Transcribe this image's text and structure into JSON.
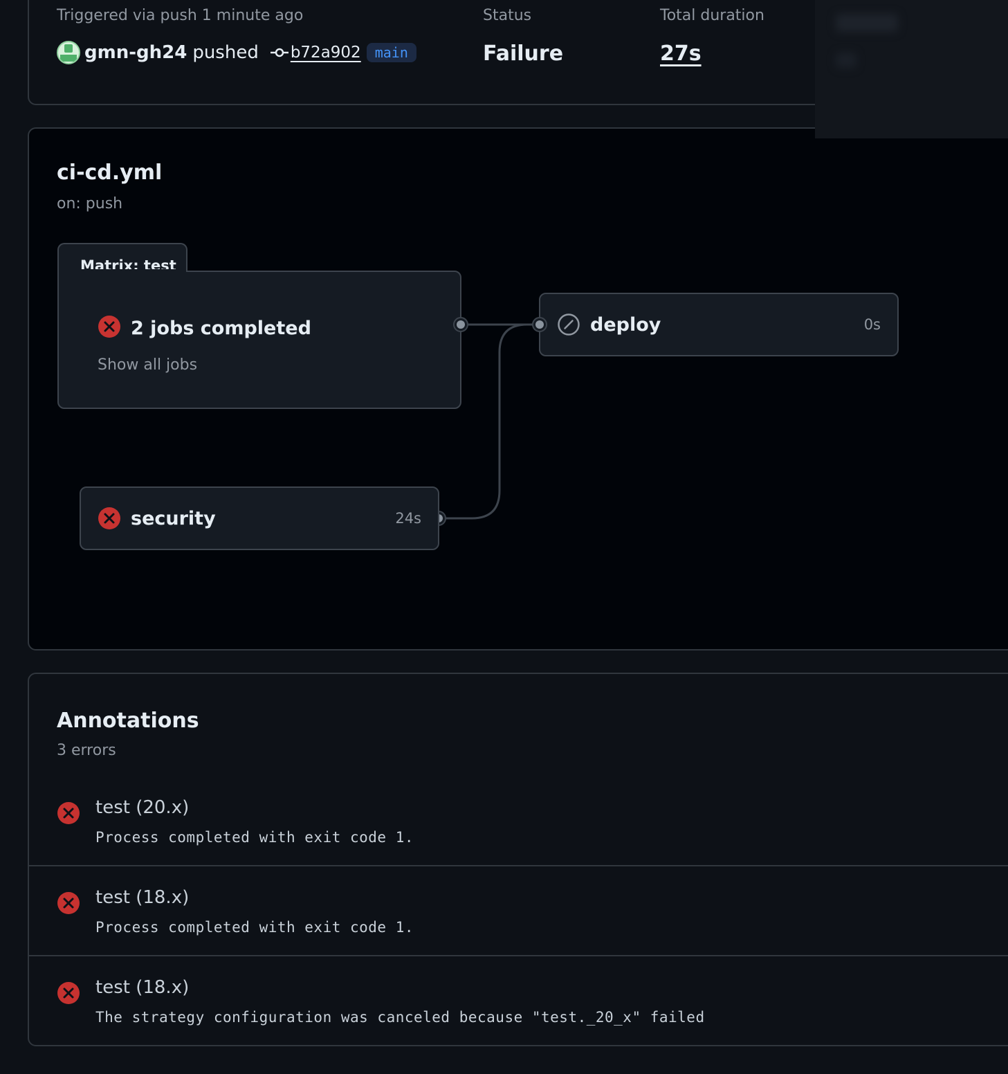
{
  "colors": {
    "failure": "#da3633",
    "muted": "#9198a1",
    "branch_fg": "#4493f8",
    "connector": "#3d444d"
  },
  "summary": {
    "trigger_text": "Triggered via push 1 minute ago",
    "actor": "gmn-gh24",
    "action": "pushed",
    "commit_sha": "b72a902",
    "branch": "main",
    "status_label": "Status",
    "status_value": "Failure",
    "duration_label": "Total duration",
    "duration_value": "27s"
  },
  "workflow": {
    "file_name": "ci-cd.yml",
    "trigger": "on: push",
    "matrix": {
      "tab_label": "Matrix: test",
      "jobs_summary": "2 jobs completed",
      "show_all": "Show all jobs",
      "status_icon": "x-circle-fill-icon"
    },
    "jobs": {
      "deploy": {
        "name": "deploy",
        "duration": "0s",
        "status_icon": "skip-icon"
      },
      "security": {
        "name": "security",
        "duration": "24s",
        "status_icon": "x-circle-fill-icon"
      }
    }
  },
  "annotations": {
    "title": "Annotations",
    "count": "3 errors",
    "items": [
      {
        "title": "test (20.x)",
        "message": "Process completed with exit code 1."
      },
      {
        "title": "test (18.x)",
        "message": "Process completed with exit code 1."
      },
      {
        "title": "test (18.x)",
        "message": "The strategy configuration was canceled because \"test._20_x\" failed"
      }
    ]
  }
}
